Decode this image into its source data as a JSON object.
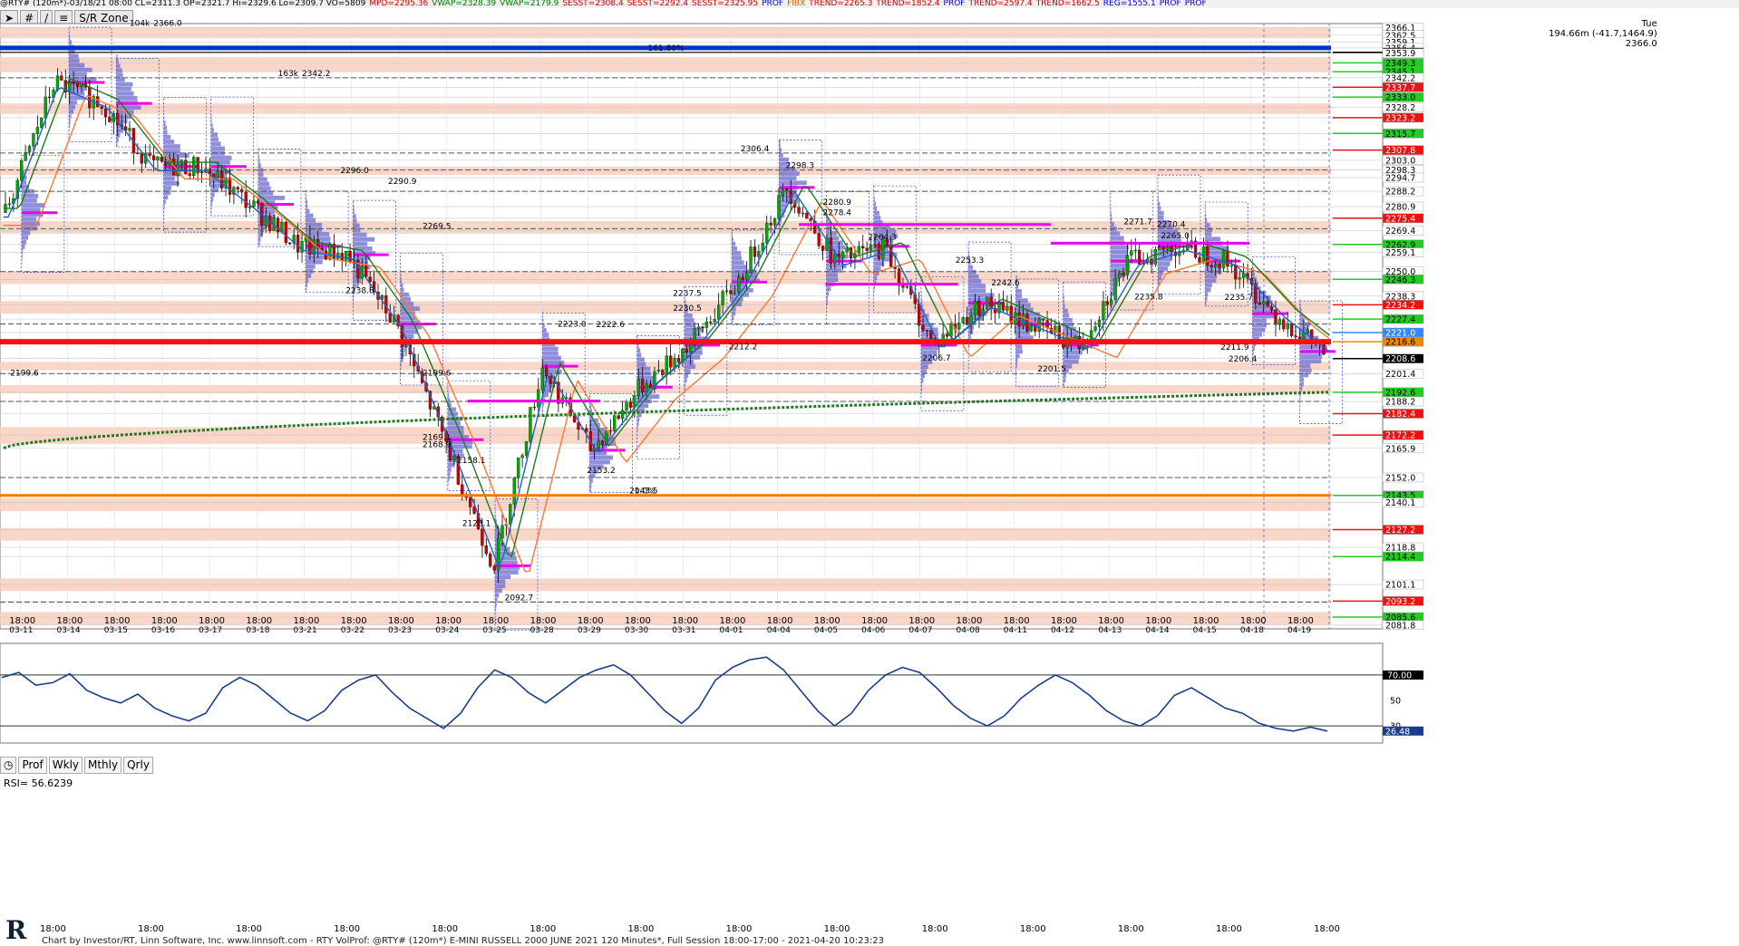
{
  "header": {
    "items": [
      {
        "label": "@RTY# (120m*)-03/18/21 08:00 CL=2311.3 OP=2321.7 Hi=2329.6 Lo=2309.7 VO=5809",
        "color": "#000000"
      },
      {
        "label": "MPD=2295.36",
        "color": "#cc0000"
      },
      {
        "label": "VWAP=2328.39",
        "color": "#007700"
      },
      {
        "label": "VWAP=2179.9",
        "color": "#007700"
      },
      {
        "label": "SESST=2308.4",
        "color": "#cc0000"
      },
      {
        "label": "SESST=2292.4",
        "color": "#cc0000"
      },
      {
        "label": "SESST=2325.95",
        "color": "#cc0000"
      },
      {
        "label": "PROF",
        "color": "#0000cc"
      },
      {
        "label": "FIBX",
        "color": "#cc6600"
      },
      {
        "label": "TREND=2265.3",
        "color": "#cc0000"
      },
      {
        "label": "TREND=1852.4",
        "color": "#cc0000"
      },
      {
        "label": "PROF",
        "color": "#0000cc"
      },
      {
        "label": "TREND=2597.4",
        "color": "#cc0000"
      },
      {
        "label": "TREND=1662.5",
        "color": "#cc0000"
      },
      {
        "label": "REG=1555.1",
        "color": "#0000cc"
      },
      {
        "label": "PROF",
        "color": "#0000cc"
      },
      {
        "label": "PROF",
        "color": "#0000cc"
      }
    ]
  },
  "toolbar": {
    "zone_label": "S/R Zone"
  },
  "info": {
    "day": "Tue",
    "measure": "194.66m (-41.7,1464.9)",
    "price": "2366.0"
  },
  "periods": {
    "prof": "Prof",
    "wkly": "Wkly",
    "mthly": "Mthly",
    "qrly": "Qrly"
  },
  "rsi": {
    "label": "RSI= 56.6239"
  },
  "footer": {
    "text": "Chart by Investor/RT, Linn Software, Inc. www.linnsoft.com - RTY  VolProf: @RTY# (120m*) E-MINI RUSSELL 2000 JUNE 2021 120 Minutes*, Full Session 18:00-17:00 - 2021-04-20 10:23:23"
  },
  "logo": {
    "text": "R"
  },
  "colors": {
    "up": "#00aa00",
    "down": "#cc0000",
    "profile": "#6a6ad0",
    "vwap": "#1f7a1f",
    "fib": "#0033cc",
    "support": "#ff2020",
    "zone": "#f9cfc0"
  },
  "chart_data": {
    "type": "candlestick",
    "ylim": [
      2080.0,
      2368.0
    ],
    "x_labels": [
      {
        "time": "18:00",
        "date": "03-11"
      },
      {
        "time": "18:00",
        "date": "03-14"
      },
      {
        "time": "18:00",
        "date": "03-15"
      },
      {
        "time": "18:00",
        "date": "03-16"
      },
      {
        "time": "18:00",
        "date": "03-17"
      },
      {
        "time": "18:00",
        "date": "03-18"
      },
      {
        "time": "18:00",
        "date": "03-21"
      },
      {
        "time": "18:00",
        "date": "03-22"
      },
      {
        "time": "18:00",
        "date": "03-23"
      },
      {
        "time": "18:00",
        "date": "03-24"
      },
      {
        "time": "18:00",
        "date": "03-25"
      },
      {
        "time": "18:00",
        "date": "03-28"
      },
      {
        "time": "18:00",
        "date": "03-29"
      },
      {
        "time": "18:00",
        "date": "03-30"
      },
      {
        "time": "18:00",
        "date": "03-31"
      },
      {
        "time": "18:00",
        "date": "04-01"
      },
      {
        "time": "18:00",
        "date": "04-04"
      },
      {
        "time": "18:00",
        "date": "04-05"
      },
      {
        "time": "18:00",
        "date": "04-06"
      },
      {
        "time": "18:00",
        "date": "04-07"
      },
      {
        "time": "18:00",
        "date": "04-08"
      },
      {
        "time": "18:00",
        "date": "04-11"
      },
      {
        "time": "18:00",
        "date": "04-12"
      },
      {
        "time": "18:00",
        "date": "04-13"
      },
      {
        "time": "18:00",
        "date": "04-14"
      },
      {
        "time": "18:00",
        "date": "04-15"
      },
      {
        "time": "18:00",
        "date": "04-18"
      },
      {
        "time": "18:00",
        "date": "04-19"
      }
    ],
    "session_closes": [
      2278,
      2340,
      2330,
      2300,
      2300,
      2282,
      2262,
      2258,
      2225,
      2170,
      2110,
      2205,
      2165,
      2195,
      2215,
      2245,
      2290,
      2255,
      2262,
      2215,
      2235,
      2225,
      2215,
      2255,
      2262,
      2255,
      2230,
      2212
    ],
    "price_labels": [
      {
        "v": 2366.1,
        "c": "#ffffff"
      },
      {
        "v": 2362.5,
        "c": "#ffffff"
      },
      {
        "v": 2359.1,
        "c": "#ffffff"
      },
      {
        "v": 2356.4,
        "c": "#ffffff"
      },
      {
        "v": 2354.3,
        "c": "#000000"
      },
      {
        "v": 2353.9,
        "c": "#ffffff"
      },
      {
        "v": 2349.3,
        "c": "#22cc22"
      },
      {
        "v": 2345.1,
        "c": "#22cc22"
      },
      {
        "v": 2342.2,
        "c": "#ffffff"
      },
      {
        "v": 2337.7,
        "c": "#ee1111"
      },
      {
        "v": 2333.0,
        "c": "#22cc22"
      },
      {
        "v": 2328.2,
        "c": "#ffffff"
      },
      {
        "v": 2323.2,
        "c": "#ee1111"
      },
      {
        "v": 2315.7,
        "c": "#22cc22"
      },
      {
        "v": 2307.8,
        "c": "#ee1111"
      },
      {
        "v": 2303.0,
        "c": "#ffffff"
      },
      {
        "v": 2298.3,
        "c": "#ffffff"
      },
      {
        "v": 2294.7,
        "c": "#ffffff"
      },
      {
        "v": 2288.2,
        "c": "#ffffff"
      },
      {
        "v": 2280.9,
        "c": "#ffffff"
      },
      {
        "v": 2275.4,
        "c": "#ee1111"
      },
      {
        "v": 2269.4,
        "c": "#ffffff"
      },
      {
        "v": 2262.9,
        "c": "#22cc22"
      },
      {
        "v": 2259.1,
        "c": "#ffffff"
      },
      {
        "v": 2250.0,
        "c": "#ffffff"
      },
      {
        "v": 2246.3,
        "c": "#22cc22"
      },
      {
        "v": 2238.3,
        "c": "#ffffff"
      },
      {
        "v": 2234.2,
        "c": "#ee1111"
      },
      {
        "v": 2227.4,
        "c": "#22cc22"
      },
      {
        "v": 2221.0,
        "c": "#3388ff"
      },
      {
        "v": 2216.6,
        "c": "#ee8800"
      },
      {
        "v": 2208.6,
        "c": "#000000"
      },
      {
        "v": 2201.4,
        "c": "#ffffff"
      },
      {
        "v": 2192.6,
        "c": "#22cc22"
      },
      {
        "v": 2188.2,
        "c": "#ffffff"
      },
      {
        "v": 2182.4,
        "c": "#ee1111"
      },
      {
        "v": 2172.2,
        "c": "#ee1111"
      },
      {
        "v": 2165.9,
        "c": "#ffffff"
      },
      {
        "v": 2152.0,
        "c": "#ffffff"
      },
      {
        "v": 2143.5,
        "c": "#22cc22"
      },
      {
        "v": 2140.1,
        "c": "#ffffff"
      },
      {
        "v": 2127.2,
        "c": "#ee1111"
      },
      {
        "v": 2118.8,
        "c": "#ffffff"
      },
      {
        "v": 2114.4,
        "c": "#22cc22"
      },
      {
        "v": 2101.1,
        "c": "#ffffff"
      },
      {
        "v": 2093.2,
        "c": "#ee1111"
      },
      {
        "v": 2085.6,
        "c": "#22cc22"
      },
      {
        "v": 2081.8,
        "c": "#ffffff"
      }
    ],
    "annotations": [
      {
        "text": "2366.0",
        "x": 0.113,
        "y": 2366.0
      },
      {
        "text": "104k",
        "x": 0.095,
        "y": 2366.0
      },
      {
        "text": "2342.2",
        "x": 0.225,
        "y": 2342.2
      },
      {
        "text": "163k",
        "x": 0.207,
        "y": 2342.2
      },
      {
        "text": "2306.4",
        "x": 0.556,
        "y": 2306.4
      },
      {
        "text": "2298.3",
        "x": 0.59,
        "y": 2298.3
      },
      {
        "text": "2296.0",
        "x": 0.254,
        "y": 2296.0
      },
      {
        "text": "2290.9",
        "x": 0.29,
        "y": 2290.9
      },
      {
        "text": "2280.9",
        "x": 0.618,
        "y": 2280.9
      },
      {
        "text": "2278.4",
        "x": 0.618,
        "y": 2276.0
      },
      {
        "text": "2271.7",
        "x": 0.845,
        "y": 2271.7
      },
      {
        "text": "2270.4",
        "x": 0.87,
        "y": 2270.4
      },
      {
        "text": "2269.5",
        "x": 0.316,
        "y": 2269.5
      },
      {
        "text": "2264.3",
        "x": 0.652,
        "y": 2264.3
      },
      {
        "text": "2265.0",
        "x": 0.873,
        "y": 2265.0
      },
      {
        "text": "2253.3",
        "x": 0.718,
        "y": 2253.3
      },
      {
        "text": "2242.6",
        "x": 0.745,
        "y": 2242.6
      },
      {
        "text": "2238.8",
        "x": 0.258,
        "y": 2238.8
      },
      {
        "text": "2237.5",
        "x": 0.505,
        "y": 2237.5
      },
      {
        "text": "2235.8",
        "x": 0.853,
        "y": 2235.8
      },
      {
        "text": "2235.7",
        "x": 0.921,
        "y": 2235.7
      },
      {
        "text": "2230.5",
        "x": 0.505,
        "y": 2230.5
      },
      {
        "text": "2223.0",
        "x": 0.418,
        "y": 2223.0
      },
      {
        "text": "2222.6",
        "x": 0.447,
        "y": 2222.6
      },
      {
        "text": "2212.2",
        "x": 0.547,
        "y": 2212.2
      },
      {
        "text": "2211.9",
        "x": 0.918,
        "y": 2211.9
      },
      {
        "text": "2206.7",
        "x": 0.693,
        "y": 2206.7
      },
      {
        "text": "2206.4",
        "x": 0.924,
        "y": 2206.4
      },
      {
        "text": "2201.5",
        "x": 0.78,
        "y": 2201.5
      },
      {
        "text": "2199.6",
        "x": 0.005,
        "y": 2199.6
      },
      {
        "text": "2199.6",
        "x": 0.316,
        "y": 2199.6
      },
      {
        "text": "2169.1",
        "x": 0.316,
        "y": 2169.1
      },
      {
        "text": "2168.9",
        "x": 0.316,
        "y": 2165.5
      },
      {
        "text": "2158.1",
        "x": 0.342,
        "y": 2158.1
      },
      {
        "text": "2153.2",
        "x": 0.44,
        "y": 2153.2
      },
      {
        "text": "2143.5",
        "x": 0.472,
        "y": 2143.5
      },
      {
        "text": "2128.1",
        "x": 0.346,
        "y": 2128.1
      },
      {
        "text": "2092.7",
        "x": 0.378,
        "y": 2092.7
      },
      {
        "text": "161.80%",
        "x": 0.486,
        "y": 2354.3
      },
      {
        "text": "0.0%",
        "x": 0.476,
        "y": 2143.5
      }
    ],
    "levels": [
      {
        "v": 2356.4,
        "c": "#0033cc",
        "w": 5
      },
      {
        "v": 2354.3,
        "c": "#000000",
        "w": 1
      },
      {
        "v": 2216.6,
        "c": "#ff1010",
        "w": 6
      },
      {
        "v": 2143.5,
        "c": "#ff7700",
        "w": 3
      },
      {
        "v": 2342.2,
        "c": "#555555",
        "w": 1,
        "dash": "6,3"
      },
      {
        "v": 2306.4,
        "c": "#555555",
        "w": 1,
        "dash": "6,3"
      },
      {
        "v": 2298.3,
        "c": "#555555",
        "w": 1,
        "dash": "6,3"
      },
      {
        "v": 2288.2,
        "c": "#555555",
        "w": 1,
        "dash": "6,3"
      },
      {
        "v": 2270.4,
        "c": "#555555",
        "w": 1,
        "dash": "6,3"
      },
      {
        "v": 2250.0,
        "c": "#555555",
        "w": 1,
        "dash": "6,3"
      },
      {
        "v": 2225.1,
        "c": "#555555",
        "w": 1,
        "dash": "6,3"
      },
      {
        "v": 2201.5,
        "c": "#555555",
        "w": 1,
        "dash": "6,3"
      },
      {
        "v": 2188.2,
        "c": "#555555",
        "w": 1,
        "dash": "6,3"
      },
      {
        "v": 2152.0,
        "c": "#555555",
        "w": 1,
        "dash": "6,3"
      },
      {
        "v": 2092.7,
        "c": "#555555",
        "w": 1,
        "dash": "6,3"
      },
      {
        "v": 2263.5,
        "c": "#ee00ee",
        "w": 3,
        "from": 0.79,
        "to": 0.94
      },
      {
        "v": 2272.4,
        "c": "#ee00ee",
        "w": 3,
        "from": 0.6,
        "to": 0.79
      },
      {
        "v": 2244.0,
        "c": "#ee00ee",
        "w": 3,
        "from": 0.62,
        "to": 0.72
      },
      {
        "v": 2188.4,
        "c": "#ee00ee",
        "w": 3,
        "from": 0.35,
        "to": 0.45
      }
    ],
    "zones": [
      [
        2361,
        2366
      ],
      [
        2345,
        2352
      ],
      [
        2325,
        2330
      ],
      [
        2296,
        2300
      ],
      [
        2268,
        2274
      ],
      [
        2244,
        2250
      ],
      [
        2230,
        2236
      ],
      [
        2203,
        2207
      ],
      [
        2192,
        2196
      ],
      [
        2168,
        2176
      ],
      [
        2136,
        2142
      ],
      [
        2122,
        2128
      ],
      [
        2098,
        2104
      ],
      [
        2082,
        2088
      ]
    ],
    "vwap_start": 2166.0,
    "vwap_end": 2192.6,
    "rsi_values": [
      68,
      72,
      62,
      64,
      71,
      58,
      52,
      48,
      55,
      44,
      38,
      34,
      40,
      60,
      68,
      62,
      51,
      40,
      34,
      42,
      58,
      66,
      70,
      56,
      44,
      36,
      28,
      40,
      60,
      74,
      68,
      56,
      48,
      58,
      68,
      74,
      78,
      70,
      56,
      42,
      32,
      44,
      66,
      76,
      82,
      84,
      74,
      58,
      42,
      30,
      40,
      58,
      70,
      76,
      72,
      60,
      46,
      36,
      30,
      38,
      52,
      62,
      70,
      64,
      54,
      42,
      34,
      30,
      38,
      54,
      60,
      52,
      44,
      40,
      32,
      28,
      26,
      29,
      26
    ],
    "rsi_ylim": [
      18,
      92
    ],
    "rsi_levels": [
      {
        "v": 70,
        "label": "70.00"
      },
      {
        "v": 50,
        "label": "50"
      },
      {
        "v": 30,
        "label": "30"
      }
    ],
    "rsi_last": "26.48"
  }
}
